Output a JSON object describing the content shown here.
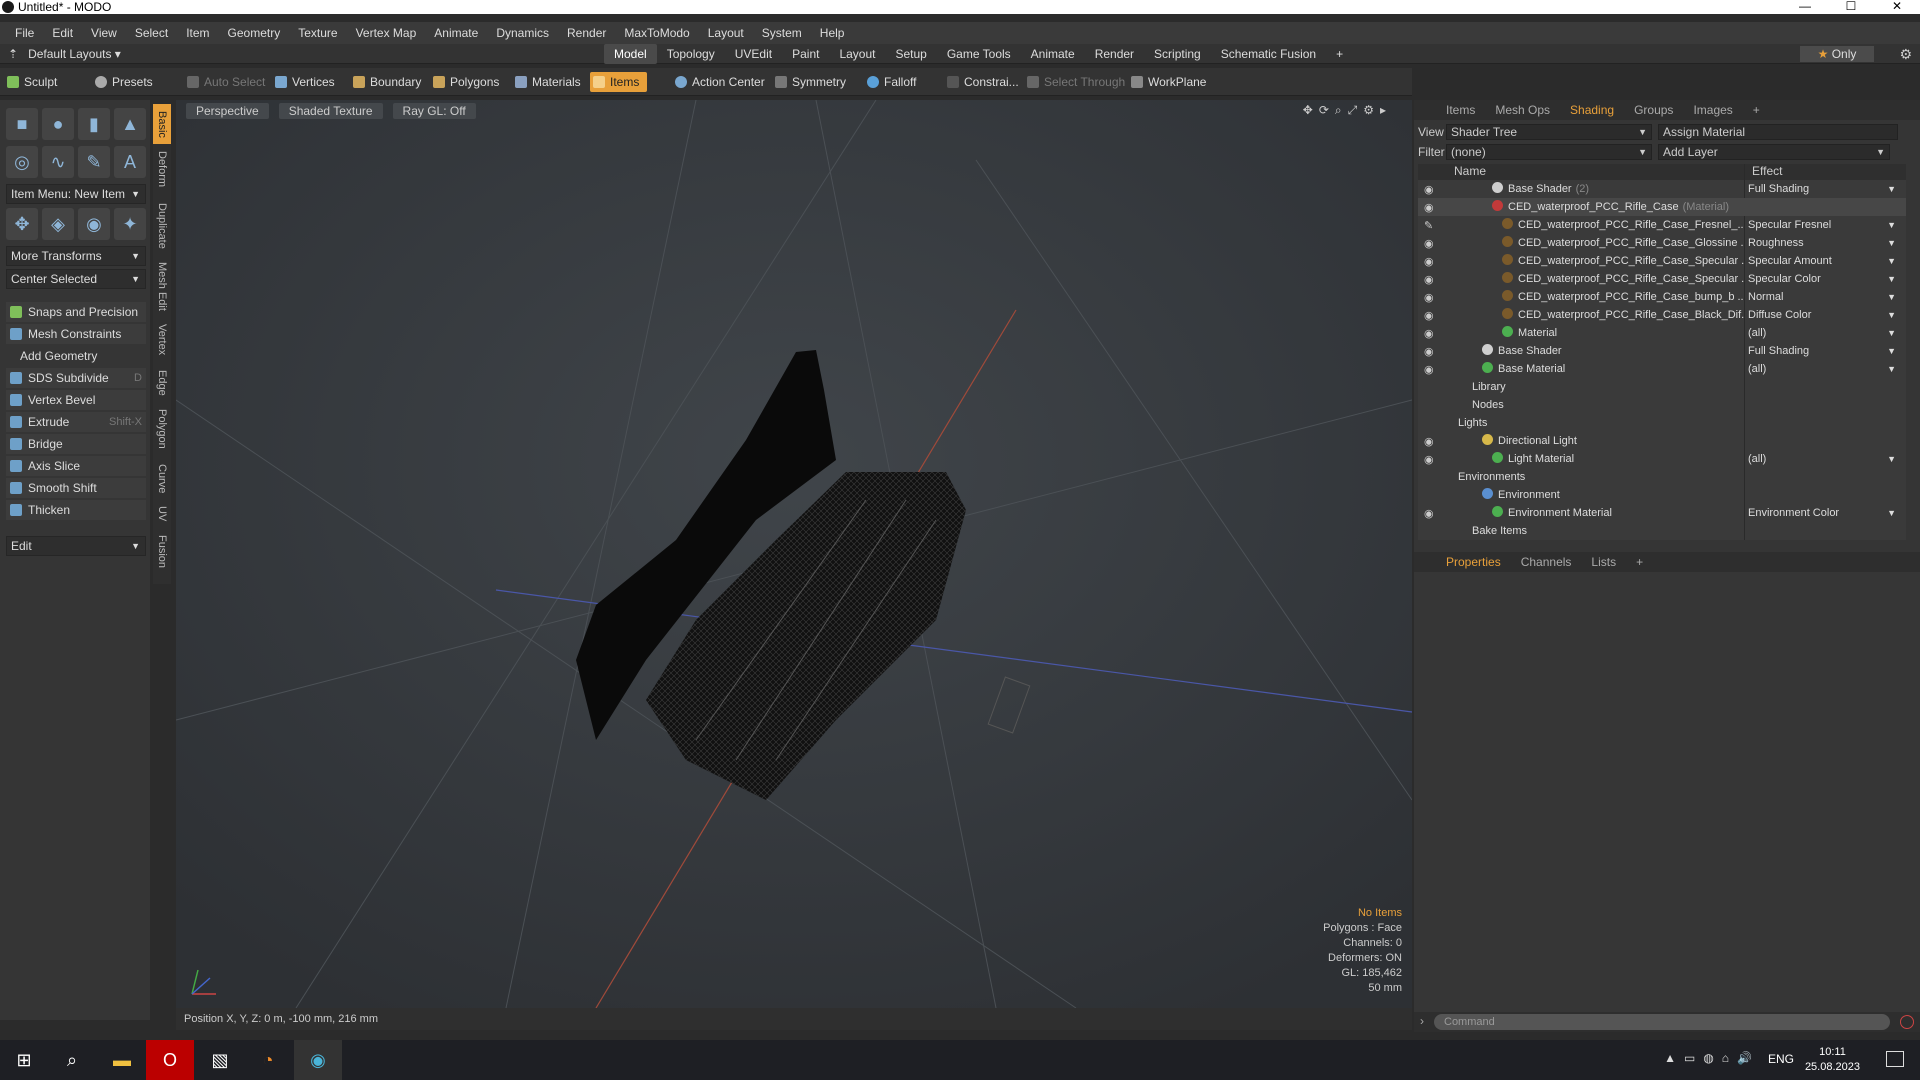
{
  "window": {
    "title": "Untitled* - MODO",
    "minimize": "—",
    "maximize": "☐",
    "close": "✕"
  },
  "menu": [
    "File",
    "Edit",
    "View",
    "Select",
    "Item",
    "Geometry",
    "Texture",
    "Vertex Map",
    "Animate",
    "Dynamics",
    "Render",
    "MaxToModo",
    "Layout",
    "System",
    "Help"
  ],
  "layout": {
    "default": "Default Layouts",
    "tabs": [
      "Model",
      "Topology",
      "UVEdit",
      "Paint",
      "Layout",
      "Setup",
      "Game Tools",
      "Animate",
      "Render",
      "Scripting",
      "Schematic Fusion",
      "+"
    ],
    "active_tab": "Model",
    "only": "Only"
  },
  "toolbar": {
    "sculpt": "Sculpt",
    "presets": "Presets",
    "auto_select": "Auto Select",
    "vertices": "Vertices",
    "boundary": "Boundary",
    "polygons": "Polygons",
    "materials": "Materials",
    "items": "Items",
    "action_center": "Action Center",
    "symmetry": "Symmetry",
    "falloff": "Falloff",
    "constraints": "Constrai...",
    "select_through": "Select Through",
    "workplane": "WorkPlane"
  },
  "left": {
    "item_menu": "Item Menu: New Item",
    "more_transforms": "More Transforms",
    "center_selected": "Center Selected",
    "snaps": "Snaps and Precision",
    "mesh_constraints": "Mesh Constraints",
    "add_geometry": "Add Geometry",
    "tools": [
      {
        "label": "SDS Subdivide",
        "shortcut": "D"
      },
      {
        "label": "Vertex Bevel",
        "shortcut": ""
      },
      {
        "label": "Extrude",
        "shortcut": "Shift-X"
      },
      {
        "label": "Bridge",
        "shortcut": ""
      },
      {
        "label": "Axis Slice",
        "shortcut": ""
      },
      {
        "label": "Smooth Shift",
        "shortcut": ""
      },
      {
        "label": "Thicken",
        "shortcut": ""
      }
    ],
    "edit": "Edit"
  },
  "side_tabs": [
    "Basic",
    "Deform",
    "Duplicate",
    "Mesh Edit",
    "Vertex",
    "Edge",
    "Polygon",
    "Curve",
    "UV",
    "Fusion"
  ],
  "viewport": {
    "view": "Perspective",
    "shading": "Shaded Texture",
    "raygl": "Ray GL: Off",
    "stats": {
      "items": "No Items",
      "polygons": "Polygons : Face",
      "channels": "Channels: 0",
      "deformers": "Deformers: ON",
      "gl": "GL: 185,462",
      "scale": "50 mm"
    },
    "position": "Position X, Y, Z:  0 m, -100 mm, 216 mm"
  },
  "right": {
    "tabs": [
      "Items",
      "Mesh Ops",
      "Shading",
      "Groups",
      "Images",
      "+"
    ],
    "active_tab": "Shading",
    "view_label": "View",
    "view_value": "Shader Tree",
    "assign": "Assign Material",
    "filter_label": "Filter",
    "filter_value": "(none)",
    "add_layer": "Add Layer",
    "col_name": "Name",
    "col_effect": "Effect",
    "tree": [
      {
        "name": "Base Shader",
        "sub": "(2)",
        "effect": "Full Shading",
        "indent": 1,
        "ball": "#cfcfcf",
        "eye": true
      },
      {
        "name": "CED_waterproof_PCC_Rifle_Case",
        "sub": "(Material)",
        "effect": "",
        "indent": 1,
        "ball": "#c23a3a",
        "eye": true,
        "open": true
      },
      {
        "name": "CED_waterproof_PCC_Rifle_Case_Fresnel_...",
        "sub": "",
        "effect": "Specular Fresnel",
        "indent": 2,
        "ball": "#7a5a2a",
        "eye": "brush"
      },
      {
        "name": "CED_waterproof_PCC_Rifle_Case_Glossine ...",
        "sub": "",
        "effect": "Roughness",
        "indent": 2,
        "ball": "#7a5a2a",
        "eye": true
      },
      {
        "name": "CED_waterproof_PCC_Rifle_Case_Specular ...",
        "sub": "",
        "effect": "Specular Amount",
        "indent": 2,
        "ball": "#7a5a2a",
        "eye": true
      },
      {
        "name": "CED_waterproof_PCC_Rifle_Case_Specular ...",
        "sub": "",
        "effect": "Specular Color",
        "indent": 2,
        "ball": "#7a5a2a",
        "eye": true
      },
      {
        "name": "CED_waterproof_PCC_Rifle_Case_bump_b ...",
        "sub": "",
        "effect": "Normal",
        "indent": 2,
        "ball": "#7a5a2a",
        "eye": true
      },
      {
        "name": "CED_waterproof_PCC_Rifle_Case_Black_Dif...",
        "sub": "",
        "effect": "Diffuse Color",
        "indent": 2,
        "ball": "#7a5a2a",
        "eye": true
      },
      {
        "name": "Material",
        "sub": "",
        "effect": "(all)",
        "indent": 2,
        "ball": "#4caf50",
        "eye": true
      },
      {
        "name": "Base Shader",
        "sub": "",
        "effect": "Full Shading",
        "indent": 0,
        "ball": "#cfcfcf",
        "eye": true
      },
      {
        "name": "Base Material",
        "sub": "",
        "effect": "(all)",
        "indent": 0,
        "ball": "#4caf50",
        "eye": true
      },
      {
        "name": "Library",
        "sub": "",
        "effect": "",
        "indent": -1,
        "ball": "",
        "eye": false
      },
      {
        "name": "Nodes",
        "sub": "",
        "effect": "",
        "indent": -1,
        "ball": "",
        "eye": false
      },
      {
        "name": "Lights",
        "sub": "",
        "effect": "",
        "indent": -2,
        "ball": "",
        "eye": false
      },
      {
        "name": "Directional Light",
        "sub": "",
        "effect": "",
        "indent": 0,
        "ball": "#d6b84a",
        "eye": true
      },
      {
        "name": "Light Material",
        "sub": "",
        "effect": "(all)",
        "indent": 1,
        "ball": "#4caf50",
        "eye": true
      },
      {
        "name": "Environments",
        "sub": "",
        "effect": "",
        "indent": -2,
        "ball": "",
        "eye": false
      },
      {
        "name": "Environment",
        "sub": "",
        "effect": "",
        "indent": 0,
        "ball": "#5a8fd0",
        "eye": false
      },
      {
        "name": "Environment Material",
        "sub": "",
        "effect": "Environment Color",
        "indent": 1,
        "ball": "#4caf50",
        "eye": true
      },
      {
        "name": "Bake Items",
        "sub": "",
        "effect": "",
        "indent": -1,
        "ball": "",
        "eye": false
      }
    ],
    "props_tabs": [
      "Properties",
      "Channels",
      "Lists",
      "+"
    ],
    "command_placeholder": "Command"
  },
  "taskbar": {
    "lang": "ENG",
    "time": "10:11",
    "date": "25.08.2023"
  }
}
